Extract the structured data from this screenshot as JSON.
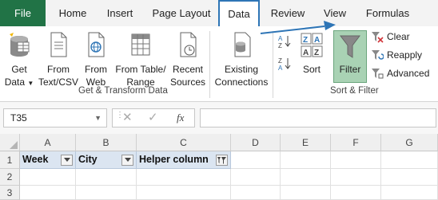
{
  "tabs": {
    "file": "File",
    "home": "Home",
    "insert": "Insert",
    "page_layout": "Page Layout",
    "data": "Data",
    "review": "Review",
    "view": "View",
    "formulas": "Formulas"
  },
  "get_transform": {
    "get_data_1": "Get",
    "get_data_2": "Data",
    "from_text_1": "From",
    "from_text_2": "Text/CSV",
    "from_web_1": "From",
    "from_web_2": "Web",
    "from_table_1": "From Table/",
    "from_table_2": "Range",
    "recent_1": "Recent",
    "recent_2": "Sources",
    "existing_1": "Existing",
    "existing_2": "Connections",
    "label": "Get & Transform Data"
  },
  "sort_filter": {
    "sort": "Sort",
    "filter": "Filter",
    "clear": "Clear",
    "reapply": "Reapply",
    "advanced": "Advanced",
    "label": "Sort & Filter"
  },
  "formula_bar": {
    "name_box": "T35",
    "fx": "fx",
    "value": ""
  },
  "grid": {
    "columns": [
      "A",
      "B",
      "C",
      "D",
      "E",
      "F",
      "G"
    ],
    "rows": [
      "1",
      "2",
      "3"
    ],
    "headers": {
      "a1": "Week",
      "b1": "City",
      "c1": "Helper column"
    }
  },
  "colors": {
    "file_tab": "#217346",
    "active_tab_border": "#2e75b6",
    "filter_active": "#a9d2b4",
    "header_fill": "#dbe5f1"
  }
}
